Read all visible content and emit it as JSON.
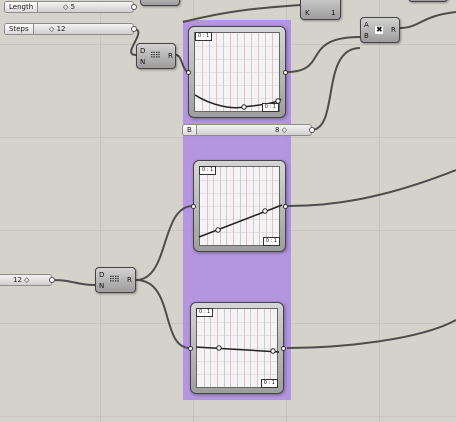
{
  "sliders": {
    "length": {
      "label": "Length",
      "value": "◇ 5"
    },
    "steps": {
      "label": "Steps",
      "value": "◇ 12"
    },
    "b": {
      "label": "B",
      "value": "8 ◇"
    },
    "left": {
      "label": "",
      "value": "12 ◇"
    }
  },
  "components": {
    "divide_top": {
      "in_d": "D",
      "in_n": "N",
      "out_r": "R",
      "icon": "⠿⠿"
    },
    "divide_bottom": {
      "in_d": "D",
      "in_n": "N",
      "out_r": "R",
      "icon": "⠿⠿"
    },
    "multiply": {
      "in_a": "A",
      "in_b": "B",
      "out_r": "R",
      "icon": "✖"
    },
    "top_right": {
      "in_k": "K",
      "out_1": "1"
    }
  },
  "mappers": [
    {
      "domain": "0 : 1",
      "range": "0 : 1"
    },
    {
      "domain": "0 : 1",
      "range": "0 : 1"
    },
    {
      "domain": "0 : 1",
      "range": "0 : 1"
    }
  ],
  "colors": {
    "canvas": "#d5d2cb",
    "group": "#a782e6",
    "wire": "#4d4d4d"
  }
}
